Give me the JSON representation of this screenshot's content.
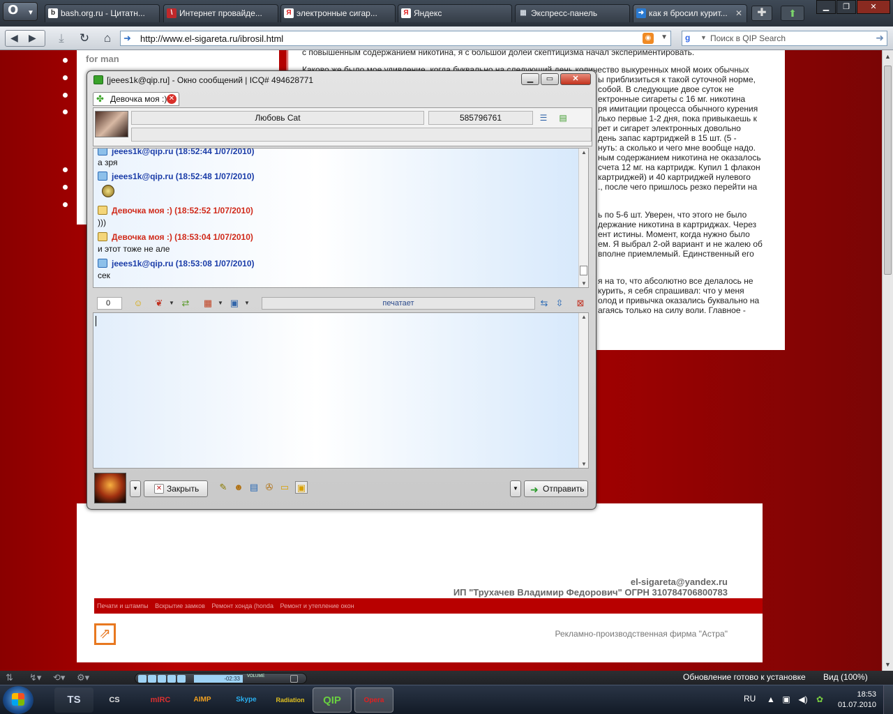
{
  "browser": {
    "menu_logo": "O",
    "tabs": [
      {
        "title": "bash.org.ru - Цитатн...",
        "favicon": "b"
      },
      {
        "title": "Интернет провайде...",
        "favicon": "\\"
      },
      {
        "title": "электронные сигар...",
        "favicon": "Я"
      },
      {
        "title": "Яндекс",
        "favicon": "Я"
      },
      {
        "title": "Экспресс-панель",
        "favicon": "▦"
      },
      {
        "title": "как я бросил курит...",
        "favicon": "➜"
      }
    ],
    "url": "http://www.el-sigareta.ru/ibrosil.html",
    "search_placeholder": "Поиск в QIP Search",
    "status": {
      "update_text": "Обновление готово к установке",
      "zoom": "Вид (100%)",
      "player_time": "-02:33",
      "player_volume_label": "VOLUME"
    }
  },
  "page": {
    "left_heading": "for man",
    "article": [
      "с повышенным содержанием никотина, я с большой долей скептицизма начал экспериментировать.",
      "Каково же было мое удивление, когда буквально на следующий день количество выкуренных мной моих обычных",
      "ы приблизиться к такой суточной норме,",
      "собой.  В  следующие  двое  суток  не",
      "ектронные  сигареты  с  16  мг.  никотина",
      "ря имитации процесса обычного курения",
      "лько первые 1-2 дня, пока привыкаешь к",
      "рет  и  сигарет  электронных  довольно",
      "день запас картриджей в 15 шт. (5 -",
      "нуть: а сколько и чего мне вообще надо.",
      "ным содержанием никотина не оказалось",
      "счета 12 мг. на картридж. Купил 1 флакон",
      "картриджей)  и  40  картриджей  нулевого",
      "., после чего пришлось резко перейти на",
      "ь по 5-6 шт.  Уверен, что этого не было",
      "держание никотина в картриджах.  Через",
      "ент  истины.  Момент,  когда  нужно  было",
      "ем. Я выбрал 2-ой вариант и не жалею об",
      "вполне  приемлемый.  Единственный  его",
      "я на то, что абсолютно все делалось не",
      "курить, я себя спрашивал: что у меня",
      "олод и привычка оказались буквально на",
      "агаясь только на силу воли. Главное -"
    ],
    "contact_email": "el-sigareta@yandex.ru",
    "contact_company": "ИП \"Трухачев Владимир Федорович\" ОГРН 310784706800783",
    "footer_links": [
      "Печати и штампы",
      "Вскрытие замков",
      "Ремонт хонда (honda",
      "Ремонт и утепление окон"
    ],
    "footer_credit": "Рекламно-производственная фирма \"Астра\""
  },
  "qip": {
    "title": "[jeees1k@qip.ru] - Окно сообщений | ICQ# 494628771",
    "tab_label": "Девочка моя :)",
    "contact_name": "Любовь Cat",
    "contact_uin": "585796761",
    "messages": [
      {
        "from": "jeees1k@qip.ru (18:52:44 1/07/2010)",
        "text": "а зря",
        "mine": true
      },
      {
        "from": "jeees1k@qip.ru (18:52:48 1/07/2010)",
        "text": "",
        "mine": true
      },
      {
        "from": "Девочка моя :) (18:52:52 1/07/2010)",
        "text": ")))",
        "mine": false
      },
      {
        "from": "Девочка моя :) (18:53:04 1/07/2010)",
        "text": "и этот тоже не але",
        "mine": false
      },
      {
        "from": "jeees1k@qip.ru (18:53:08 1/07/2010)",
        "text": "сек",
        "mine": true
      }
    ],
    "char_count": "0",
    "typing_status": "печатает",
    "close_label": "Закрыть",
    "send_label": "Отправить"
  },
  "taskbar": {
    "lang": "RU",
    "time": "18:53",
    "date": "01.07.2010",
    "apps": [
      "TS",
      "CS",
      "mIRC",
      "AIMP",
      "Skype",
      "Radiation",
      "QIP",
      "Opera"
    ]
  },
  "colors": {
    "page_red": "#b80000",
    "my_nick": "#1a3ca8",
    "her_nick": "#d02a1a"
  }
}
